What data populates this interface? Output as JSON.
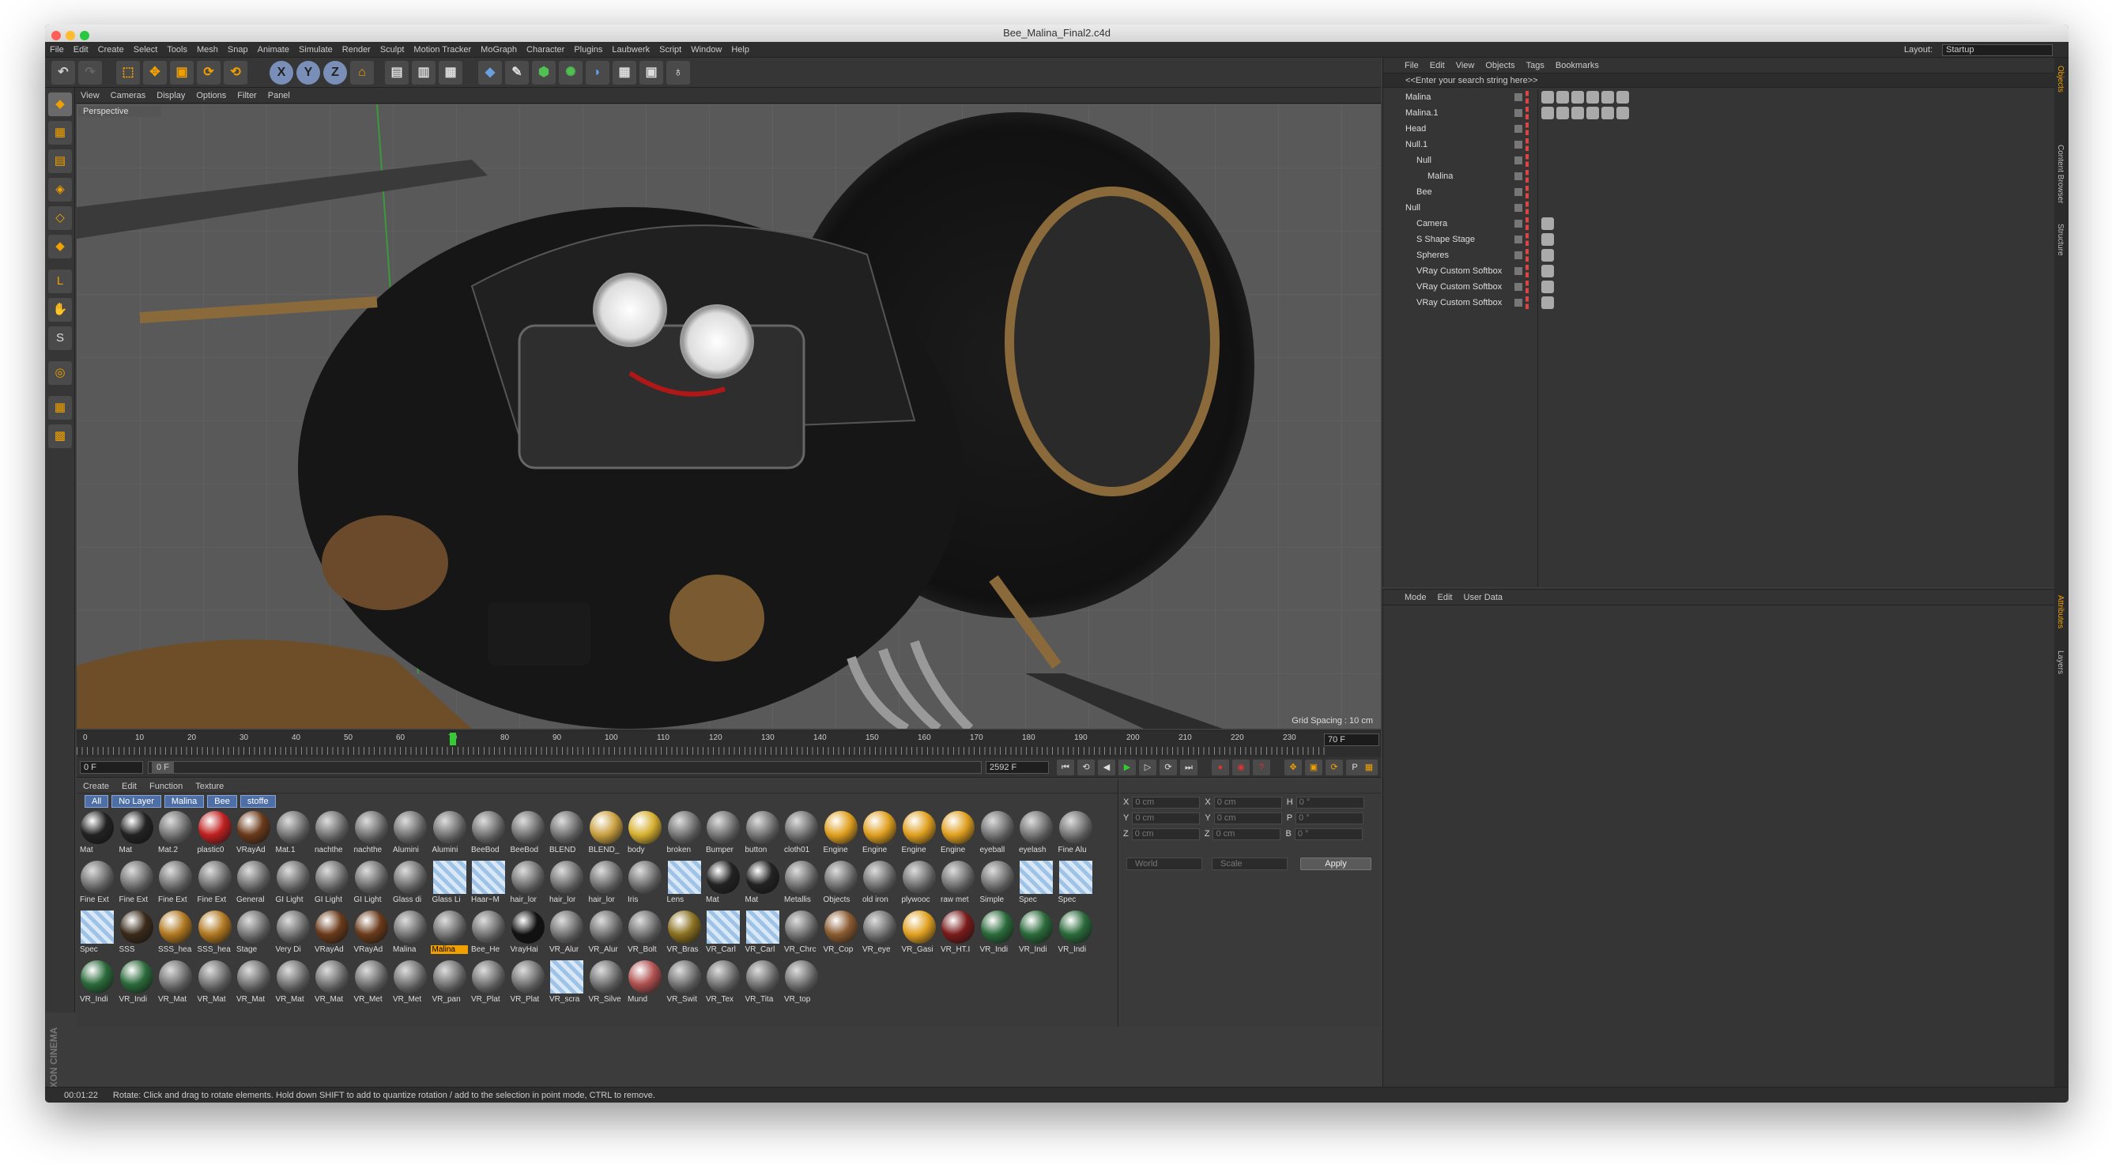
{
  "window": {
    "title": "Bee_Malina_Final2.c4d"
  },
  "menu": [
    "File",
    "Edit",
    "Create",
    "Select",
    "Tools",
    "Mesh",
    "Snap",
    "Animate",
    "Simulate",
    "Render",
    "Sculpt",
    "Motion Tracker",
    "MoGraph",
    "Character",
    "Plugins",
    "Laubwerk",
    "Script",
    "Window",
    "Help"
  ],
  "layout": {
    "label": "Layout:",
    "value": "Startup"
  },
  "toolbar": {
    "x_label": "X",
    "y_label": "Y",
    "z_label": "Z"
  },
  "viewport": {
    "menu": [
      "View",
      "Cameras",
      "Display",
      "Options",
      "Filter",
      "Panel"
    ],
    "label": "Perspective",
    "grid_spacing": "Grid Spacing : 10 cm"
  },
  "timeline": {
    "ticks": [
      "0",
      "10",
      "20",
      "30",
      "40",
      "50",
      "60",
      "70",
      "80",
      "90",
      "100",
      "110",
      "120",
      "130",
      "140",
      "150",
      "160",
      "170",
      "180",
      "190",
      "200",
      "210",
      "220",
      "230"
    ],
    "current_frame": "70 F"
  },
  "playback": {
    "start": "0 F",
    "range": "0 F",
    "range_end": "2592 F",
    "end": "2592 F"
  },
  "materials": {
    "menu": [
      "Create",
      "Edit",
      "Function",
      "Texture"
    ],
    "filters": [
      "All",
      "No Layer",
      "Malina",
      "Bee",
      "stoffe"
    ],
    "rows": [
      [
        "Mat",
        "Mat",
        "Mat.2",
        "plastic0",
        "VRayAd",
        "Mat.1",
        "nachthe",
        "nachthe",
        "Alumini",
        "Alumini",
        "BeeBod",
        "BeeBod",
        "BLEND",
        "BLEND_",
        "body",
        "broken",
        "Bumper",
        "button",
        "cloth01",
        "Engine",
        "Engine",
        "Engine",
        "Engine",
        "eyeball",
        "eyelash",
        "Fine Alu"
      ],
      [
        "Fine Ext",
        "Fine Ext",
        "Fine Ext",
        "Fine Ext",
        "General",
        "GI Light",
        "GI Light",
        "GI Light",
        "Glass di",
        "Glass Li",
        "Haar~M",
        "hair_lor",
        "hair_lor",
        "hair_lor",
        "Iris",
        "Lens",
        "Mat",
        "Mat",
        "Metallis",
        "Objects",
        "old iron",
        "plywooc",
        "raw met",
        "Simple",
        "Spec",
        "Spec"
      ],
      [
        "Spec",
        "SSS",
        "SSS_hea",
        "SSS_hea",
        "Stage",
        "Very Di",
        "VRayAd",
        "VRayAd",
        "Malina",
        "Malina",
        "Bee_He",
        "VrayHai",
        "VR_Alur",
        "VR_Alur",
        "VR_Bolt",
        "VR_Bras",
        "VR_Carl",
        "VR_Carl",
        "VR_Chrc",
        "VR_Cop",
        "VR_eye",
        "VR_Gasi",
        "VR_HT.I",
        "VR_Indi",
        "VR_Indi",
        "VR_Indi"
      ],
      [
        "VR_Indi",
        "VR_Indi",
        "VR_Mat",
        "VR_Mat",
        "VR_Mat",
        "VR_Mat",
        "VR_Mat",
        "VR_Met",
        "VR_Met",
        "VR_pan",
        "VR_Plat",
        "VR_Plat",
        "VR_scra",
        "VR_Silve",
        "Mund",
        "VR_Swit",
        "VR_Tex",
        "VR_Tita",
        "VR_top"
      ]
    ],
    "selected": "Malina"
  },
  "coordinates": {
    "rows": [
      {
        "a": "X",
        "av": "0 cm",
        "b": "X",
        "bv": "0 cm",
        "c": "H",
        "cv": "0 °"
      },
      {
        "a": "Y",
        "av": "0 cm",
        "b": "Y",
        "bv": "0 cm",
        "c": "P",
        "cv": "0 °"
      },
      {
        "a": "Z",
        "av": "0 cm",
        "b": "Z",
        "bv": "0 cm",
        "c": "B",
        "cv": "0 °"
      }
    ],
    "space": "World",
    "mode": "Scale",
    "apply": "Apply"
  },
  "objects": {
    "menu": [
      "File",
      "Edit",
      "View",
      "Objects",
      "Tags",
      "Bookmarks"
    ],
    "search": "<<Enter your search string here>>",
    "items": [
      {
        "name": "Malina",
        "indent": 0
      },
      {
        "name": "Malina.1",
        "indent": 0
      },
      {
        "name": "Head",
        "indent": 0
      },
      {
        "name": "Null.1",
        "indent": 0
      },
      {
        "name": "Null",
        "indent": 1
      },
      {
        "name": "Malina",
        "indent": 2
      },
      {
        "name": "Bee",
        "indent": 1
      },
      {
        "name": "Null",
        "indent": 0
      },
      {
        "name": "Camera",
        "indent": 1
      },
      {
        "name": "S Shape Stage",
        "indent": 1
      },
      {
        "name": "Spheres",
        "indent": 1
      },
      {
        "name": "VRay Custom Softbox",
        "indent": 1
      },
      {
        "name": "VRay Custom Softbox",
        "indent": 1
      },
      {
        "name": "VRay Custom Softbox",
        "indent": 1
      }
    ]
  },
  "side_tabs": {
    "top": [
      "Objects",
      "Content Browser",
      "Structure"
    ],
    "bottom": [
      "Attributes",
      "Layers"
    ]
  },
  "attributes": {
    "menu": [
      "Mode",
      "Edit",
      "User Data"
    ]
  },
  "status": {
    "time": "00:01:22",
    "message": "Rotate: Click and drag to rotate elements. Hold down SHIFT to add to quantize rotation / add to the selection in point mode, CTRL to remove."
  },
  "brand": "MAXON CINEMA 4D",
  "colors": {
    "accent": "#f0a000",
    "selection": "#4e6fa6",
    "viewport_bg": "#595959"
  }
}
